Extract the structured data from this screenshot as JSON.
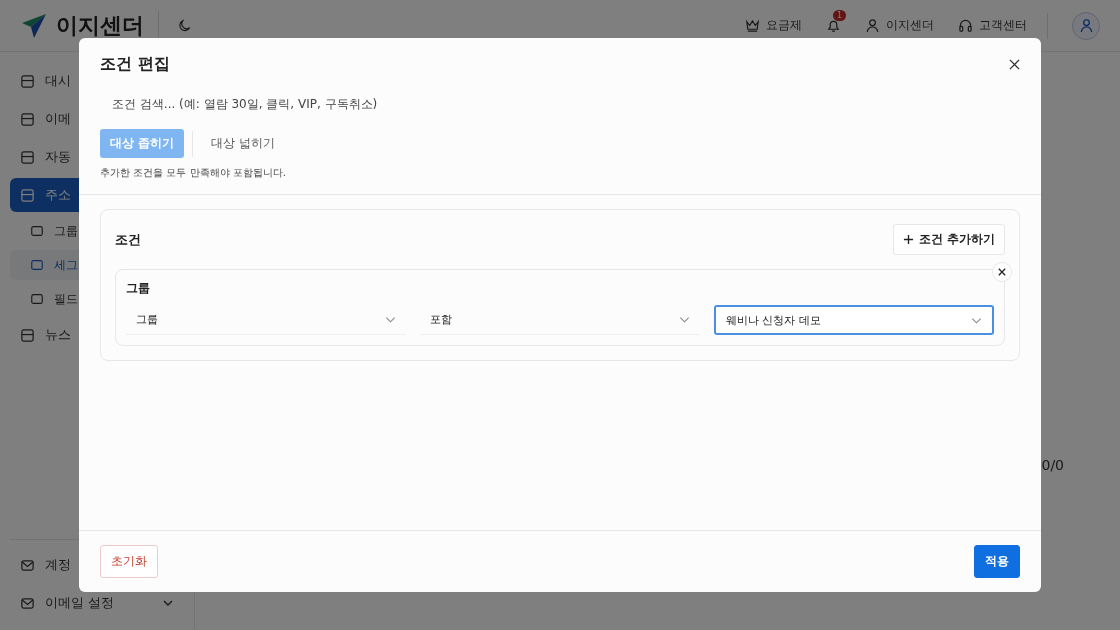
{
  "header": {
    "logo": "이지센더",
    "nav": [
      {
        "kind": "plan",
        "label": "요금제"
      },
      {
        "kind": "bell",
        "badge": "1"
      },
      {
        "kind": "user",
        "label": "이지센더"
      },
      {
        "kind": "support",
        "label": "고객센터"
      }
    ]
  },
  "sidebar": {
    "items": [
      {
        "label": "대시",
        "selected": false
      },
      {
        "label": "이메",
        "selected": false
      },
      {
        "label": "자동",
        "selected": false
      },
      {
        "label": "주소",
        "selected": true,
        "children": [
          {
            "label": "그룹",
            "selected": false
          },
          {
            "label": "세그",
            "selected": true
          },
          {
            "label": "필드",
            "selected": false
          }
        ]
      },
      {
        "label": "뉴스",
        "selected": false
      }
    ],
    "bottom": [
      {
        "label": "계정"
      },
      {
        "label": "이메일 설정",
        "expanded": false
      }
    ]
  },
  "main": {
    "counter": "0/0"
  },
  "dialog": {
    "title": "조건 편집",
    "search": {
      "placeholder": "조건 검색... (예: 열람 30일, 클릭, VIP, 구독취소)"
    },
    "tabs": [
      {
        "label": "대상 좁히기",
        "selected": true
      },
      {
        "label": "대상 넓히기",
        "selected": false
      }
    ],
    "hint": "추가한 조건을 모두 만족해야 포함됩니다.",
    "conditions": {
      "title": "조건",
      "add_button": "조건 추가하기",
      "groups": [
        {
          "title": "그룹",
          "fields": [
            {
              "value": "그룹",
              "focused": false
            },
            {
              "value": "포함",
              "focused": false
            },
            {
              "value": "웨비나 신청자 데모",
              "focused": true
            }
          ]
        }
      ]
    },
    "footer": [
      {
        "kind": "reset",
        "label": "초기화"
      },
      {
        "kind": "apply",
        "label": "적용"
      }
    ]
  }
}
